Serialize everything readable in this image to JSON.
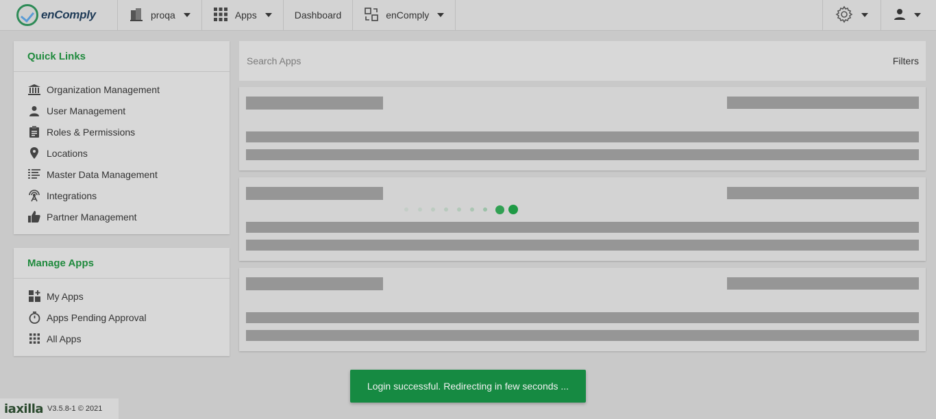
{
  "navbar": {
    "brand": "enComply",
    "org_label": "proqa",
    "apps_label": "Apps",
    "dashboard_label": "Dashboard",
    "product_label": "enComply"
  },
  "quick_links": {
    "title": "Quick Links",
    "items": [
      {
        "label": "Organization Management",
        "icon": "bank-icon"
      },
      {
        "label": "User Management",
        "icon": "user-icon"
      },
      {
        "label": "Roles & Permissions",
        "icon": "clipboard-icon"
      },
      {
        "label": "Locations",
        "icon": "map-pin-icon"
      },
      {
        "label": "Master Data Management",
        "icon": "data-list-icon"
      },
      {
        "label": "Integrations",
        "icon": "antenna-icon"
      },
      {
        "label": "Partner Management",
        "icon": "thumbs-up-icon"
      }
    ]
  },
  "manage_apps": {
    "title": "Manage Apps",
    "items": [
      {
        "label": "My Apps",
        "icon": "apps-plus-icon"
      },
      {
        "label": "Apps Pending Approval",
        "icon": "stopwatch-icon"
      },
      {
        "label": "All Apps",
        "icon": "grid-icon"
      }
    ]
  },
  "search": {
    "placeholder": "Search Apps",
    "filters_label": "Filters"
  },
  "toast": {
    "message": "Login successful. Redirecting in few seconds ..."
  },
  "footer": {
    "logo": "iaxilla",
    "version": "V3.5.8-1 © 2021"
  },
  "colors": {
    "accent_green": "#1f8a3d",
    "toast_green": "#168a42",
    "skeleton_gray": "#969696"
  }
}
